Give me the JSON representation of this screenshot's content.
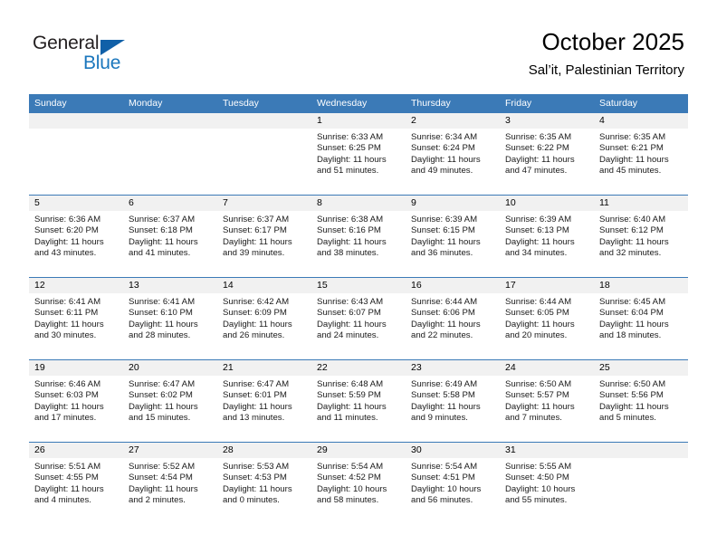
{
  "logo": {
    "word_one": "General",
    "word_two": "Blue",
    "triangle_color": "#1060a8"
  },
  "header": {
    "title": "October 2025",
    "subtitle": "Sal’it, Palestinian Territory"
  },
  "theme": {
    "header_blue": "#3b7ab7",
    "daynum_band": "#f1f1f1",
    "text": "#000000"
  },
  "weekday_headers": [
    "Sunday",
    "Monday",
    "Tuesday",
    "Wednesday",
    "Thursday",
    "Friday",
    "Saturday"
  ],
  "weeks": [
    [
      {
        "day": "",
        "lines": []
      },
      {
        "day": "",
        "lines": []
      },
      {
        "day": "",
        "lines": []
      },
      {
        "day": "1",
        "lines": [
          "Sunrise: 6:33 AM",
          "Sunset: 6:25 PM",
          "Daylight: 11 hours",
          "and 51 minutes."
        ]
      },
      {
        "day": "2",
        "lines": [
          "Sunrise: 6:34 AM",
          "Sunset: 6:24 PM",
          "Daylight: 11 hours",
          "and 49 minutes."
        ]
      },
      {
        "day": "3",
        "lines": [
          "Sunrise: 6:35 AM",
          "Sunset: 6:22 PM",
          "Daylight: 11 hours",
          "and 47 minutes."
        ]
      },
      {
        "day": "4",
        "lines": [
          "Sunrise: 6:35 AM",
          "Sunset: 6:21 PM",
          "Daylight: 11 hours",
          "and 45 minutes."
        ]
      }
    ],
    [
      {
        "day": "5",
        "lines": [
          "Sunrise: 6:36 AM",
          "Sunset: 6:20 PM",
          "Daylight: 11 hours",
          "and 43 minutes."
        ]
      },
      {
        "day": "6",
        "lines": [
          "Sunrise: 6:37 AM",
          "Sunset: 6:18 PM",
          "Daylight: 11 hours",
          "and 41 minutes."
        ]
      },
      {
        "day": "7",
        "lines": [
          "Sunrise: 6:37 AM",
          "Sunset: 6:17 PM",
          "Daylight: 11 hours",
          "and 39 minutes."
        ]
      },
      {
        "day": "8",
        "lines": [
          "Sunrise: 6:38 AM",
          "Sunset: 6:16 PM",
          "Daylight: 11 hours",
          "and 38 minutes."
        ]
      },
      {
        "day": "9",
        "lines": [
          "Sunrise: 6:39 AM",
          "Sunset: 6:15 PM",
          "Daylight: 11 hours",
          "and 36 minutes."
        ]
      },
      {
        "day": "10",
        "lines": [
          "Sunrise: 6:39 AM",
          "Sunset: 6:13 PM",
          "Daylight: 11 hours",
          "and 34 minutes."
        ]
      },
      {
        "day": "11",
        "lines": [
          "Sunrise: 6:40 AM",
          "Sunset: 6:12 PM",
          "Daylight: 11 hours",
          "and 32 minutes."
        ]
      }
    ],
    [
      {
        "day": "12",
        "lines": [
          "Sunrise: 6:41 AM",
          "Sunset: 6:11 PM",
          "Daylight: 11 hours",
          "and 30 minutes."
        ]
      },
      {
        "day": "13",
        "lines": [
          "Sunrise: 6:41 AM",
          "Sunset: 6:10 PM",
          "Daylight: 11 hours",
          "and 28 minutes."
        ]
      },
      {
        "day": "14",
        "lines": [
          "Sunrise: 6:42 AM",
          "Sunset: 6:09 PM",
          "Daylight: 11 hours",
          "and 26 minutes."
        ]
      },
      {
        "day": "15",
        "lines": [
          "Sunrise: 6:43 AM",
          "Sunset: 6:07 PM",
          "Daylight: 11 hours",
          "and 24 minutes."
        ]
      },
      {
        "day": "16",
        "lines": [
          "Sunrise: 6:44 AM",
          "Sunset: 6:06 PM",
          "Daylight: 11 hours",
          "and 22 minutes."
        ]
      },
      {
        "day": "17",
        "lines": [
          "Sunrise: 6:44 AM",
          "Sunset: 6:05 PM",
          "Daylight: 11 hours",
          "and 20 minutes."
        ]
      },
      {
        "day": "18",
        "lines": [
          "Sunrise: 6:45 AM",
          "Sunset: 6:04 PM",
          "Daylight: 11 hours",
          "and 18 minutes."
        ]
      }
    ],
    [
      {
        "day": "19",
        "lines": [
          "Sunrise: 6:46 AM",
          "Sunset: 6:03 PM",
          "Daylight: 11 hours",
          "and 17 minutes."
        ]
      },
      {
        "day": "20",
        "lines": [
          "Sunrise: 6:47 AM",
          "Sunset: 6:02 PM",
          "Daylight: 11 hours",
          "and 15 minutes."
        ]
      },
      {
        "day": "21",
        "lines": [
          "Sunrise: 6:47 AM",
          "Sunset: 6:01 PM",
          "Daylight: 11 hours",
          "and 13 minutes."
        ]
      },
      {
        "day": "22",
        "lines": [
          "Sunrise: 6:48 AM",
          "Sunset: 5:59 PM",
          "Daylight: 11 hours",
          "and 11 minutes."
        ]
      },
      {
        "day": "23",
        "lines": [
          "Sunrise: 6:49 AM",
          "Sunset: 5:58 PM",
          "Daylight: 11 hours",
          "and 9 minutes."
        ]
      },
      {
        "day": "24",
        "lines": [
          "Sunrise: 6:50 AM",
          "Sunset: 5:57 PM",
          "Daylight: 11 hours",
          "and 7 minutes."
        ]
      },
      {
        "day": "25",
        "lines": [
          "Sunrise: 6:50 AM",
          "Sunset: 5:56 PM",
          "Daylight: 11 hours",
          "and 5 minutes."
        ]
      }
    ],
    [
      {
        "day": "26",
        "lines": [
          "Sunrise: 5:51 AM",
          "Sunset: 4:55 PM",
          "Daylight: 11 hours",
          "and 4 minutes."
        ]
      },
      {
        "day": "27",
        "lines": [
          "Sunrise: 5:52 AM",
          "Sunset: 4:54 PM",
          "Daylight: 11 hours",
          "and 2 minutes."
        ]
      },
      {
        "day": "28",
        "lines": [
          "Sunrise: 5:53 AM",
          "Sunset: 4:53 PM",
          "Daylight: 11 hours",
          "and 0 minutes."
        ]
      },
      {
        "day": "29",
        "lines": [
          "Sunrise: 5:54 AM",
          "Sunset: 4:52 PM",
          "Daylight: 10 hours",
          "and 58 minutes."
        ]
      },
      {
        "day": "30",
        "lines": [
          "Sunrise: 5:54 AM",
          "Sunset: 4:51 PM",
          "Daylight: 10 hours",
          "and 56 minutes."
        ]
      },
      {
        "day": "31",
        "lines": [
          "Sunrise: 5:55 AM",
          "Sunset: 4:50 PM",
          "Daylight: 10 hours",
          "and 55 minutes."
        ]
      },
      {
        "day": "",
        "lines": []
      }
    ]
  ]
}
